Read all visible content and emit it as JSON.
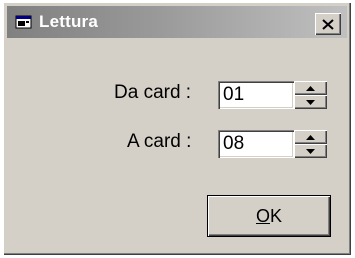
{
  "window": {
    "title": "Lettura",
    "icon": "app-window-icon",
    "close_icon": "close-icon"
  },
  "form": {
    "from_label": "Da card :",
    "from_value": "01",
    "to_label": "A card :",
    "to_value": "08"
  },
  "buttons": {
    "ok_mnemonic": "O",
    "ok_rest": "K"
  },
  "colors": {
    "face": "#d4d0c8",
    "title_start": "#808080",
    "title_end": "#c0c0c0"
  }
}
